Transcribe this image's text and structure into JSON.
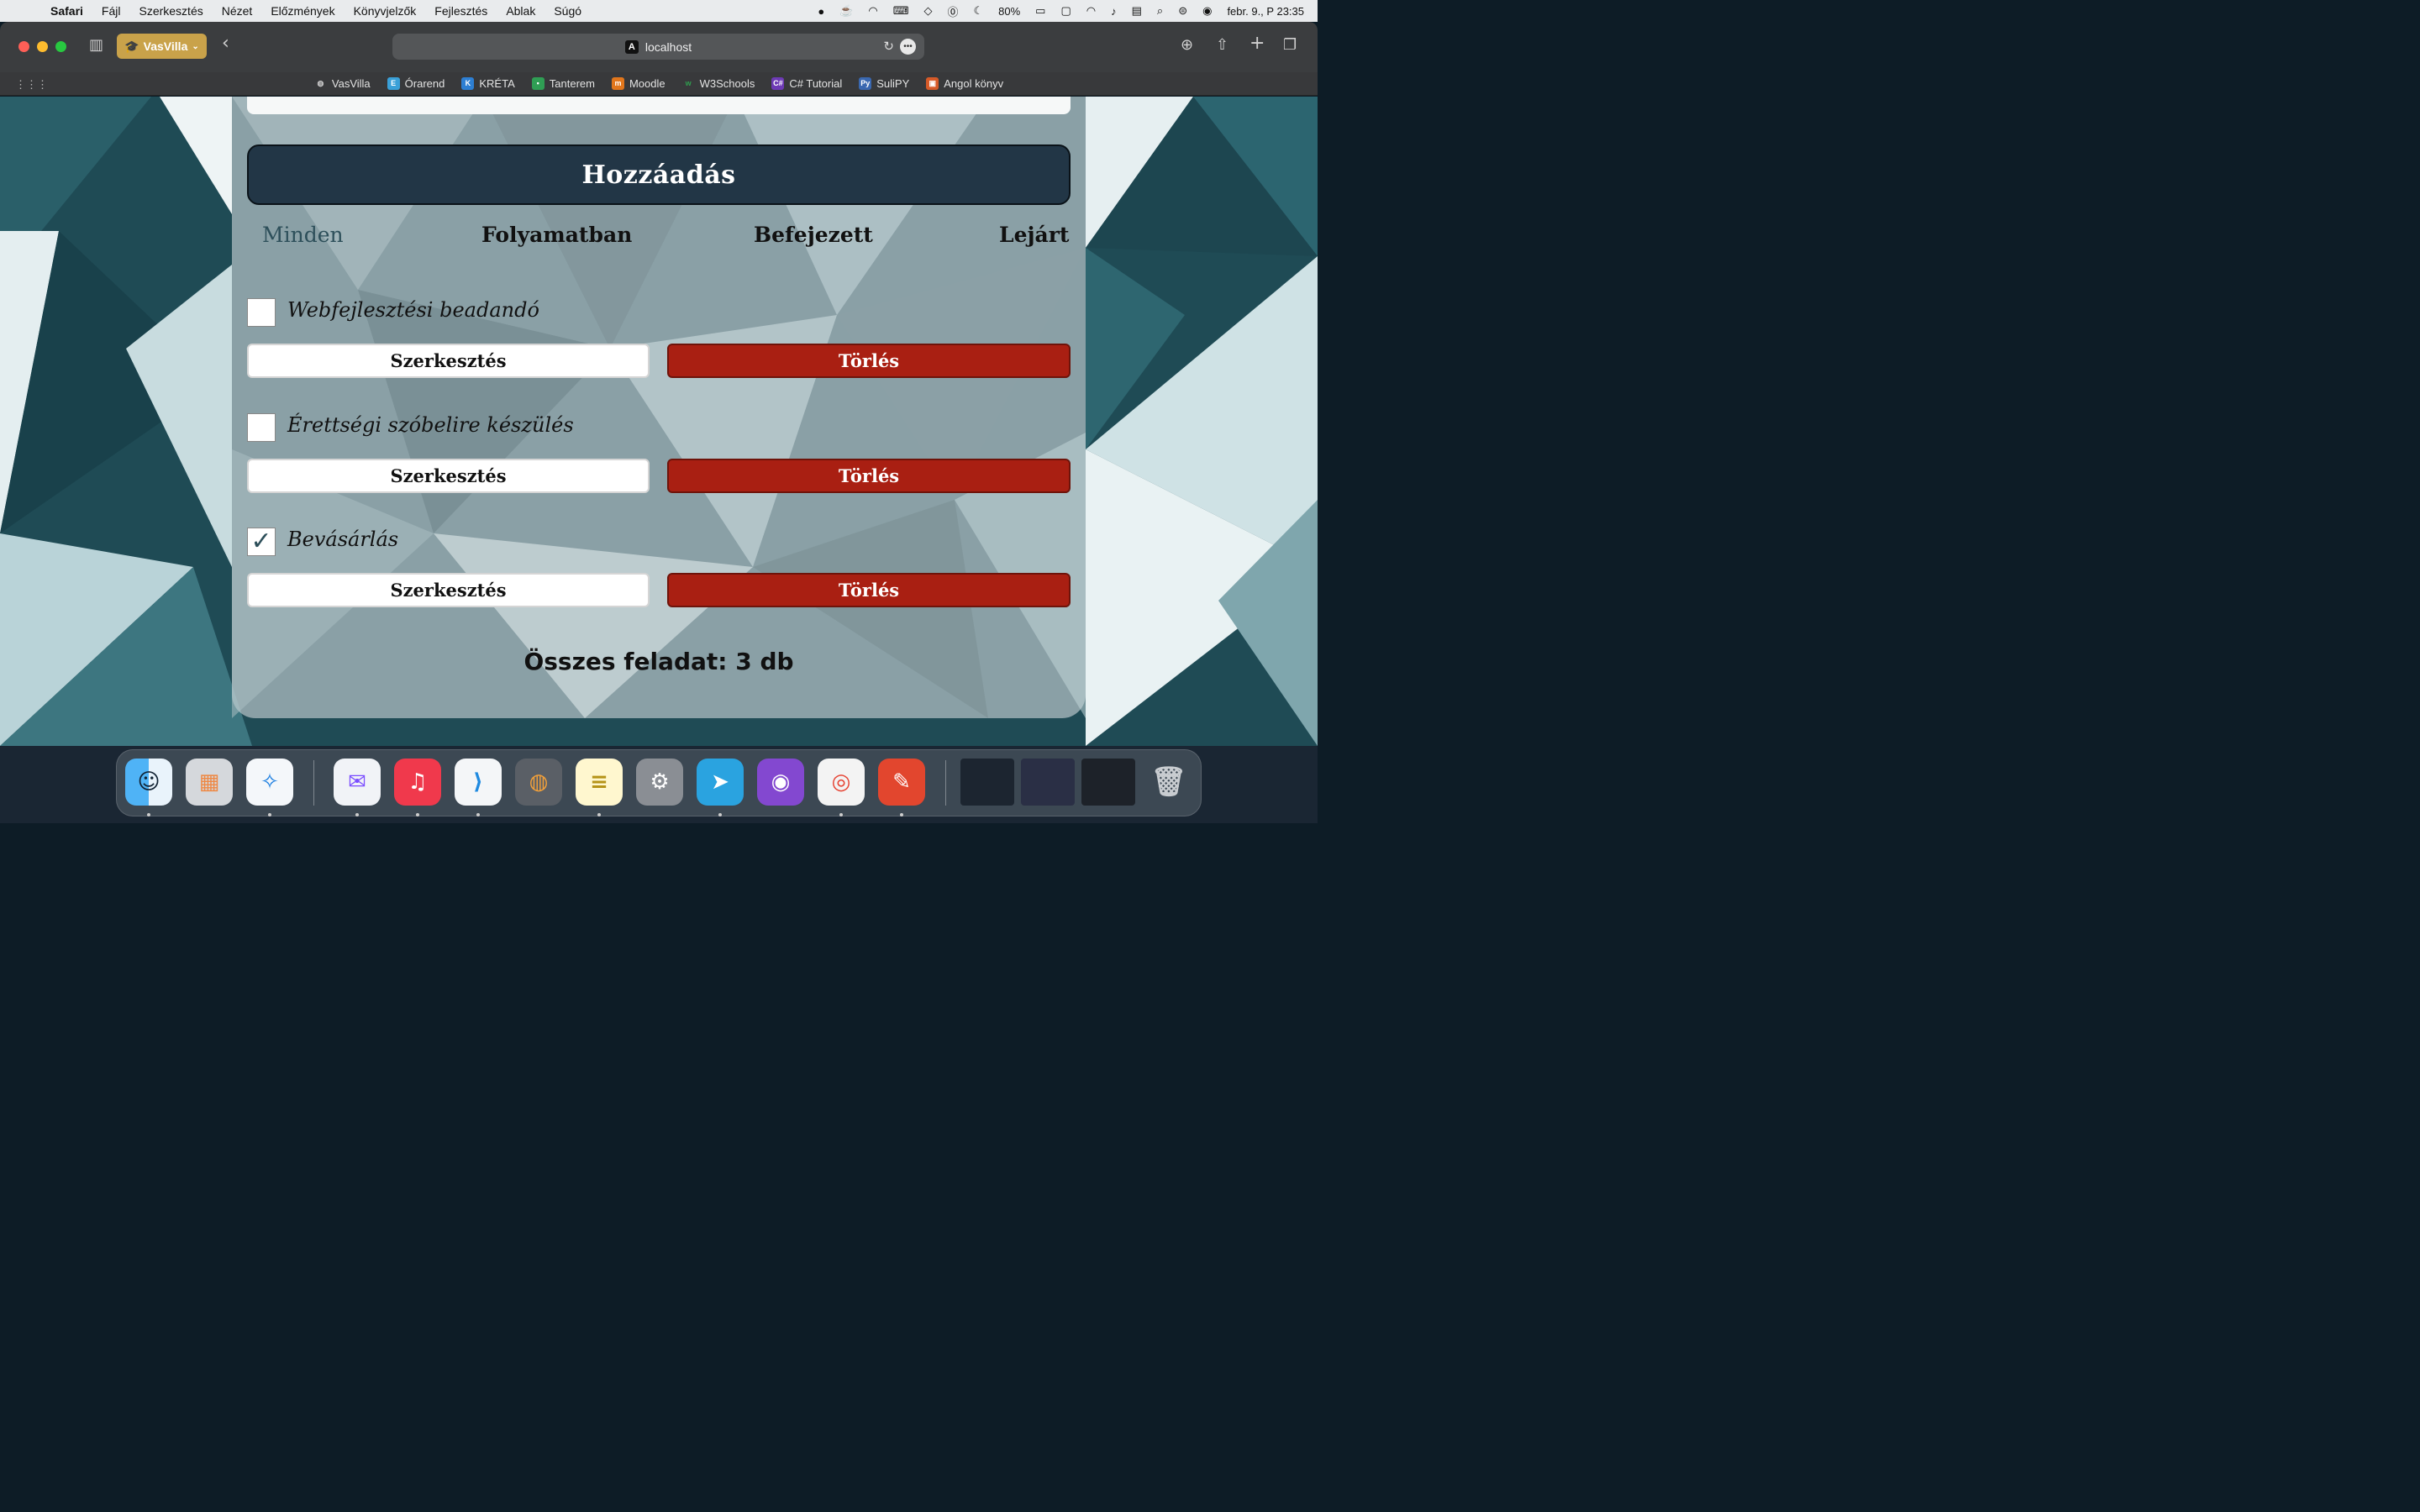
{
  "menubar": {
    "app_name": "Safari",
    "items": [
      "Fájl",
      "Szerkesztés",
      "Nézet",
      "Előzmények",
      "Könyvjelzők",
      "Fejlesztés",
      "Ablak",
      "Súgó"
    ],
    "battery": "80%",
    "datetime": "febr. 9., P  23:35"
  },
  "browser": {
    "profile_label": "VasVilla",
    "url": "localhost",
    "bookmarks": [
      "VasVilla",
      "Órarend",
      "KRÉTA",
      "Tanterem",
      "Moodle",
      "W3Schools",
      "C# Tutorial",
      "SuliPY",
      "Angol könyv"
    ]
  },
  "app": {
    "add_button": "Hozzáadás",
    "tabs": [
      "Minden",
      "Folyamatban",
      "Befejezett",
      "Lejárt"
    ],
    "tasks": [
      {
        "title": "Webfejlesztési beadandó",
        "done": false,
        "edit_label": "Szerkesztés",
        "delete_label": "Törlés"
      },
      {
        "title": "Érettségi szóbelire készülés",
        "done": false,
        "edit_label": "Szerkesztés",
        "delete_label": "Törlés"
      },
      {
        "title": "Bevásárlás",
        "done": true,
        "edit_label": "Szerkesztés",
        "delete_label": "Törlés"
      }
    ],
    "checkmark": "✓",
    "total": "Összes feladat: 3 db"
  },
  "dock": {
    "apps": [
      "finder-icon",
      "launchpad-icon",
      "safari-icon",
      "messenger-icon",
      "music-icon",
      "vscode-icon",
      "cooking-app-icon",
      "notes-icon",
      "system-settings-icon",
      "telegram-icon",
      "github-desktop-icon",
      "chrome-icon",
      "pixelmator-icon",
      "trash-icon"
    ]
  },
  "colors": {
    "primary_dark": "#223646",
    "delete_red": "#a91f12",
    "active_tab": "#2d4f5a"
  }
}
